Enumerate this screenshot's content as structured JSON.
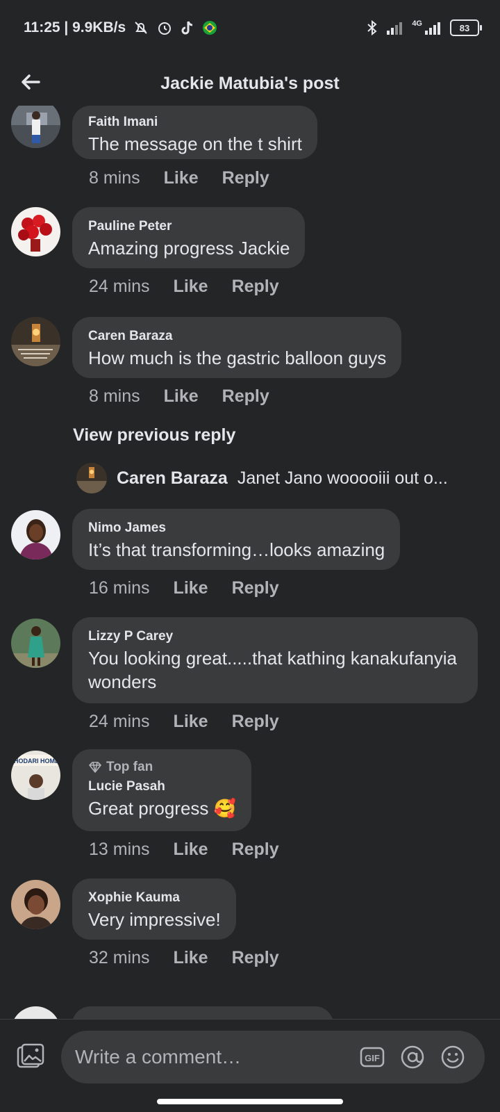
{
  "status_bar": {
    "time": "11:25 | 9.9KB/s",
    "network": "4G",
    "battery": "83"
  },
  "header": {
    "title": "Jackie Matubia's post"
  },
  "comments": [
    {
      "name": "Faith Imani",
      "text": "The message on the t shirt",
      "time": "8 mins",
      "like": "Like",
      "reply": "Reply"
    },
    {
      "name": "Pauline Peter",
      "text": "Amazing progress Jackie",
      "time": "24 mins",
      "like": "Like",
      "reply": "Reply"
    },
    {
      "name": "Caren Baraza",
      "text": "How much is the gastric balloon guys",
      "time": "8 mins",
      "like": "Like",
      "reply": "Reply"
    },
    {
      "name": "Nimo James",
      "text": "It’s that transforming…looks amazing",
      "time": "16 mins",
      "like": "Like",
      "reply": "Reply"
    },
    {
      "name": "Lizzy P Carey",
      "text": "You looking great.....that kathing kanakufanyia wonders",
      "time": "24 mins",
      "like": "Like",
      "reply": "Reply"
    },
    {
      "badge": "Top fan",
      "name": "Lucie Pasah",
      "text": "Great progress 🥰",
      "time": "13 mins",
      "like": "Like",
      "reply": "Reply"
    },
    {
      "name": "Xophie Kauma",
      "text": "Very impressive!",
      "time": "32 mins",
      "like": "Like",
      "reply": "Reply"
    }
  ],
  "view_previous_reply": "View previous reply",
  "reply_preview": {
    "name": "Caren Baraza",
    "text": "Janet Jano wooooiii out o..."
  },
  "composer": {
    "placeholder": "Write a comment…",
    "gif_label": "GIF"
  },
  "icons": {
    "back": "arrow-left-icon",
    "photo": "photo-icon",
    "gif": "gif-icon",
    "mention": "at-icon",
    "emoji": "smiley-icon",
    "top_fan": "diamond-icon"
  },
  "colors": {
    "background": "#242526",
    "bubble": "#3a3b3c",
    "text_primary": "#e4e6eb",
    "text_secondary": "#b0b3b8"
  }
}
